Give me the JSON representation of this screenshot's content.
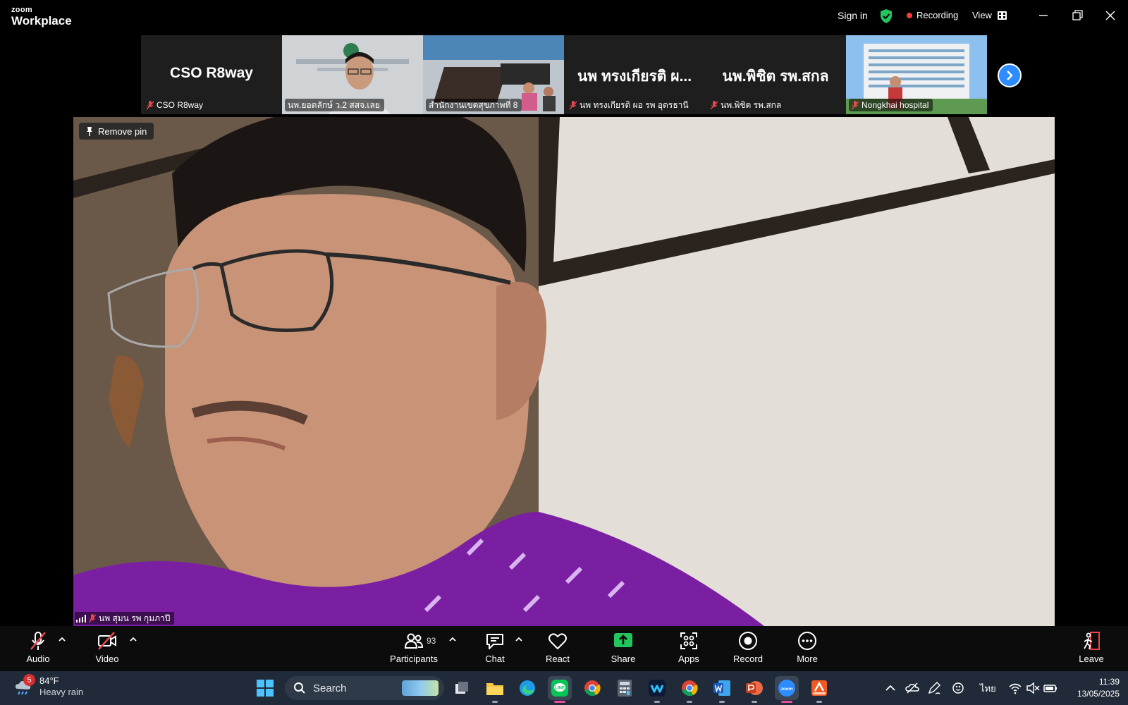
{
  "app": {
    "logo_top": "zoom",
    "logo_bottom": "Workplace",
    "sign_in": "Sign in",
    "recording_label": "Recording",
    "view_label": "View",
    "colors": {
      "accent": "#2d8cff",
      "recording": "#f43f3f",
      "secure": "#22c55e",
      "muted": "#e5484d"
    }
  },
  "gallery": {
    "tiles": [
      {
        "big_name": "CSO R8way",
        "label": "CSO R8way",
        "muted": true,
        "video": false
      },
      {
        "big_name": "",
        "label": "นพ.ยอดลักษ์ ว.2 สสจ.เลย",
        "muted": false,
        "video": true
      },
      {
        "big_name": "",
        "label": "สำนักงานเขตสุขภาพที่ 8",
        "muted": false,
        "video": true
      },
      {
        "big_name": "นพ ทรงเกียรติ ผ...",
        "label": "นพ ทรงเกียรติ ผอ รพ อุดรธานี",
        "muted": true,
        "video": false
      },
      {
        "big_name": "นพ.พิชิต รพ.สกล",
        "label": "นพ.พิชิต รพ.สกล",
        "muted": true,
        "video": false
      },
      {
        "big_name": "",
        "label": "Nongkhai hospital",
        "muted": true,
        "video": true
      }
    ],
    "next_icon": "chevron-right-icon"
  },
  "main_video": {
    "pin_label": "Remove pin",
    "speaker_label": "นพ สุมน รพ กุมภาปี"
  },
  "toolbar": {
    "audio": "Audio",
    "video": "Video",
    "participants": "Participants",
    "participants_count": "93",
    "chat": "Chat",
    "react": "React",
    "share": "Share",
    "apps": "Apps",
    "record": "Record",
    "more": "More",
    "leave": "Leave"
  },
  "taskbar": {
    "weather_badge": "5",
    "temperature": "84°F",
    "condition": "Heavy rain",
    "search_placeholder": "Search",
    "language": "ไทย",
    "time": "11:39",
    "date": "13/05/2025"
  }
}
